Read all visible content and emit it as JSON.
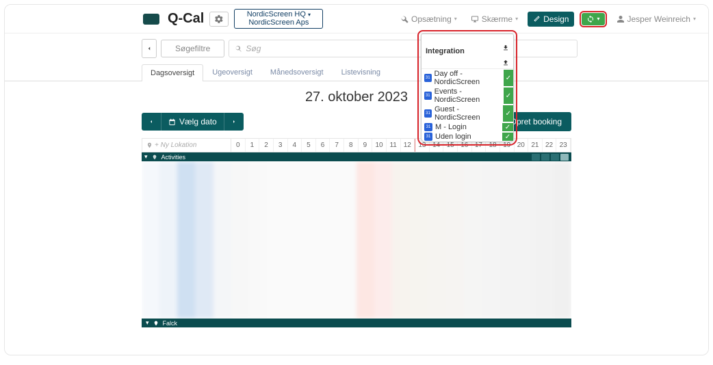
{
  "brand": {
    "name": "Q-Cal"
  },
  "org": {
    "line1": "NordicScreen HQ",
    "line2": "NordicScreen Aps"
  },
  "nav": {
    "opsatning": "Opsætning",
    "skerme": "Skærme",
    "design": "Design",
    "user": "Jesper Weinreich"
  },
  "dropdown": {
    "title": "Integration",
    "items": [
      {
        "label": "Day off - NordicScreen"
      },
      {
        "label": "Events - NordicScreen"
      },
      {
        "label": "Guest - NordicScreen"
      },
      {
        "label": "M - Login"
      },
      {
        "label": "Uden login"
      }
    ]
  },
  "subbar": {
    "filters": "Søgefiltre",
    "search_placeholder": "Søg"
  },
  "tabs": [
    {
      "label": "Dagsoversigt",
      "active": true
    },
    {
      "label": "Ugeoversigt"
    },
    {
      "label": "Månedsoversigt"
    },
    {
      "label": "Listevisning"
    }
  ],
  "date_heading": "27. oktober 2023",
  "date_picker_label": "Vælg dato",
  "create_booking": "Opret booking",
  "new_location_placeholder": "+ Ny Lokation",
  "hours": [
    "0",
    "1",
    "2",
    "3",
    "4",
    "5",
    "6",
    "7",
    "8",
    "9",
    "10",
    "11",
    "12",
    "13",
    "14",
    "15",
    "16",
    "17",
    "18",
    "19",
    "20",
    "21",
    "22",
    "23"
  ],
  "group_activities": "Activities",
  "group_falck": "Falck",
  "blur_colors": [
    "#f5f8fc",
    "#eef3f9",
    "#cfe0f2",
    "#dfe9f5",
    "#f4f6f8",
    "#f7f7f7",
    "#f9f9f9",
    "#fafafa",
    "#fafafa",
    "#fafafa",
    "#fafafa",
    "#fafafa",
    "#fde7e3",
    "#fdeceb",
    "#f7f3ee",
    "#f6f4ef",
    "#f6f4f1",
    "#f6f4f2",
    "#f5f5f4",
    "#f4f4f4",
    "#f3f3f3",
    "#f3f3f3",
    "#f2f2f2",
    "#f0f0f0"
  ]
}
